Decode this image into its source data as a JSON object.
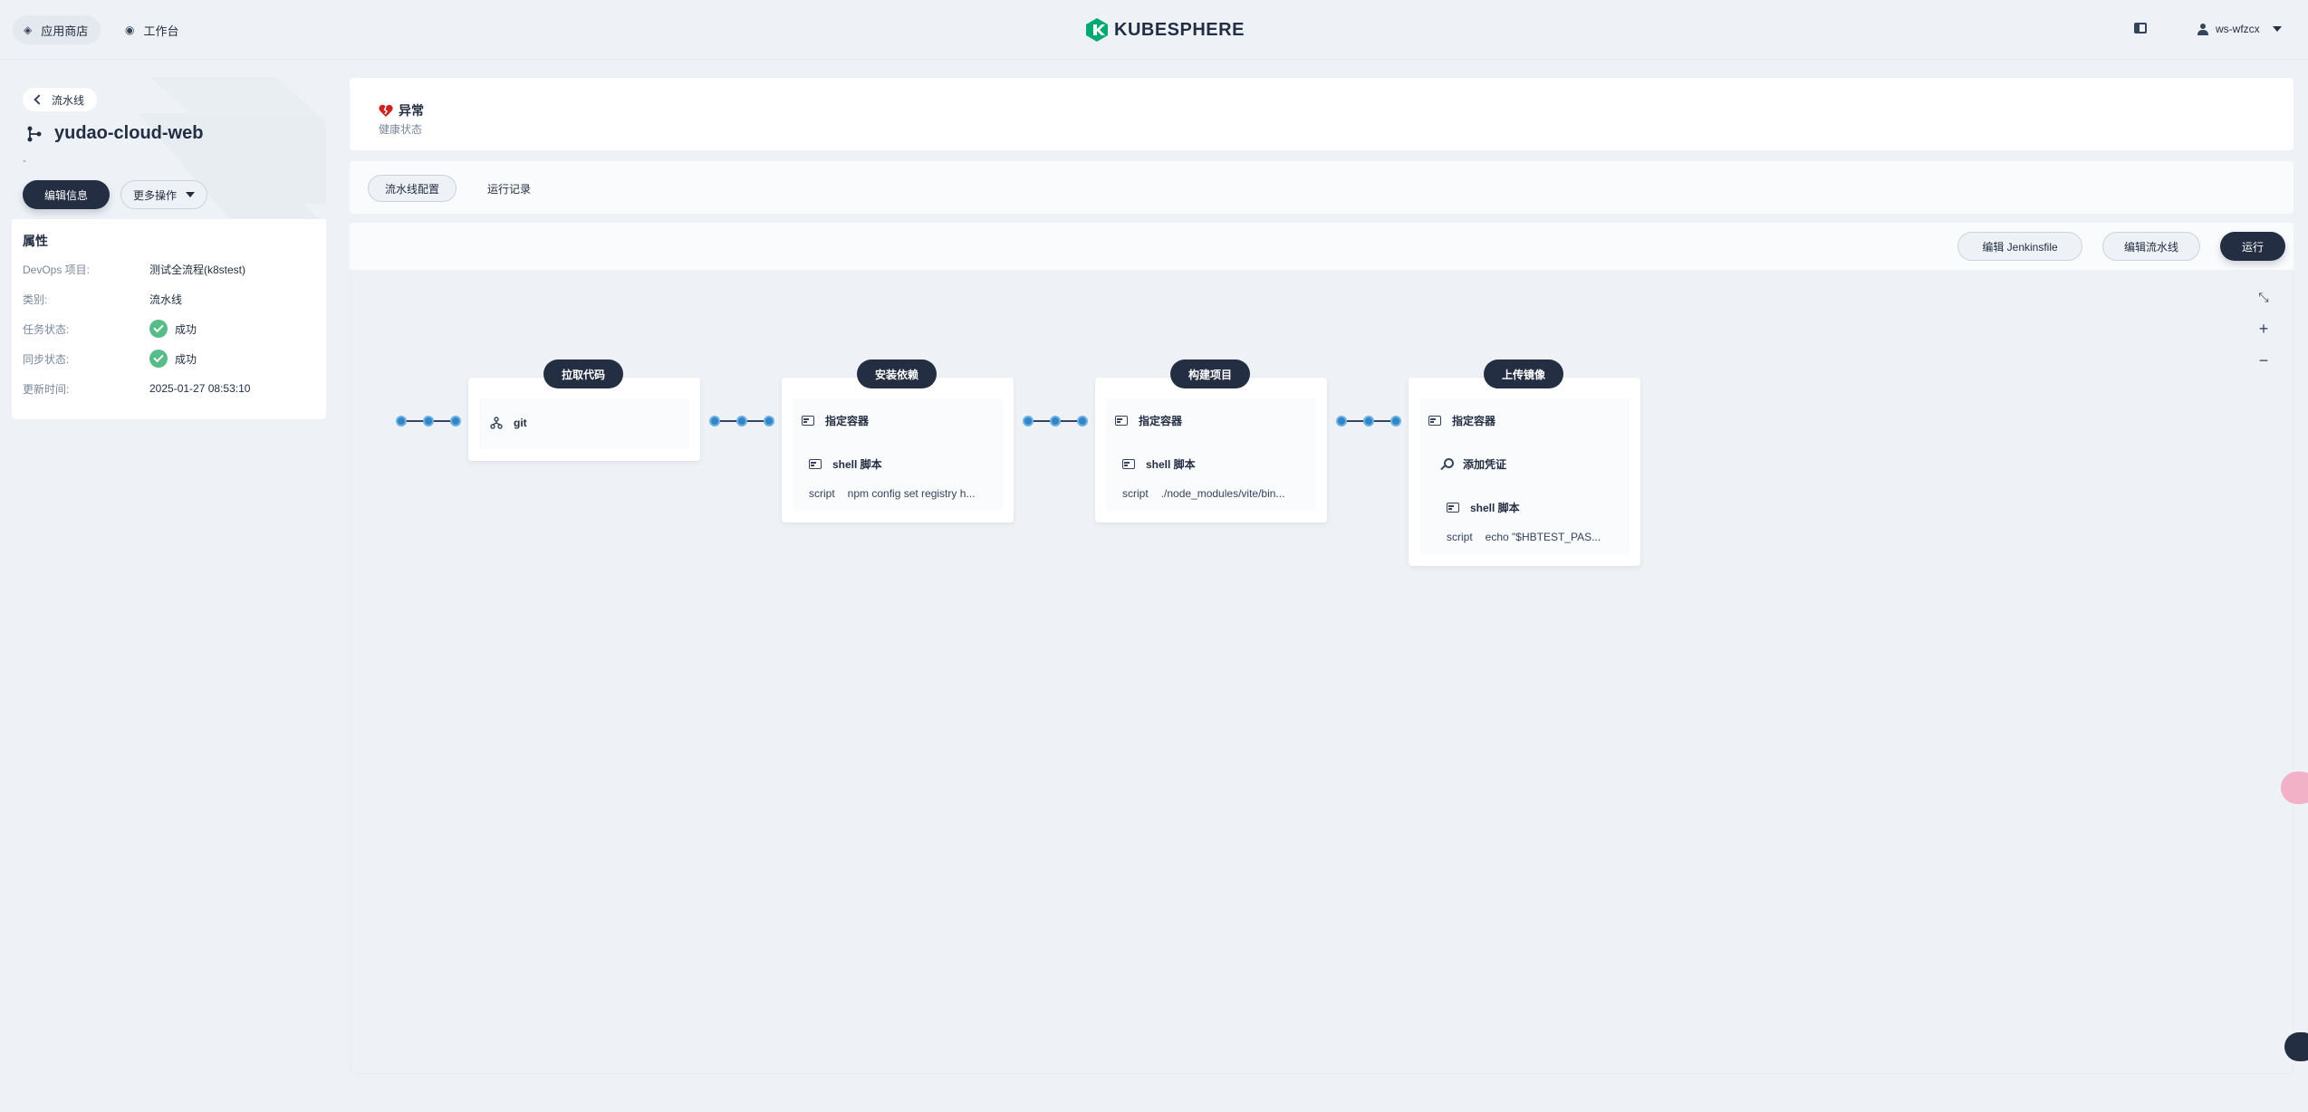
{
  "topbar": {
    "app_store_label": "应用商店",
    "workbench_label": "工作台",
    "logo_text": "KUBESPHERE",
    "brand_color": "#00a971",
    "username": "ws-wfzcx"
  },
  "sidebar": {
    "back_label": "流水线",
    "pipeline_name": "yudao-cloud-web",
    "description": "-",
    "edit_button": "编辑信息",
    "more_button": "更多操作",
    "properties_title": "属性",
    "properties": [
      {
        "key": "DevOps 项目:",
        "value": "测试全流程(k8stest)"
      },
      {
        "key": "类别:",
        "value": "流水线"
      },
      {
        "key": "任务状态:",
        "value": "成功"
      },
      {
        "key": "同步状态:",
        "value": "成功"
      },
      {
        "key": "更新时间:",
        "value": "2025-01-27 08:53:10"
      }
    ]
  },
  "health": {
    "status": "异常",
    "label": "健康状态"
  },
  "tabs": [
    {
      "label": "流水线配置"
    },
    {
      "label": "运行记录"
    }
  ],
  "toolbar": {
    "edit_jenkinsfile": "编辑 Jenkinsfile",
    "edit_pipeline": "编辑流水线",
    "run": "运行"
  },
  "stages": [
    {
      "title": "拉取代码",
      "steps": [
        {
          "label": "git"
        }
      ]
    },
    {
      "title": "安装依赖",
      "steps": [
        {
          "label": "指定容器"
        },
        {
          "label": "shell 脚本",
          "script_key": "script",
          "script_value": "npm config set registry h..."
        }
      ]
    },
    {
      "title": "构建项目",
      "steps": [
        {
          "label": "指定容器"
        },
        {
          "label": "shell 脚本",
          "script_key": "script",
          "script_value": "./node_modules/vite/bin..."
        }
      ]
    },
    {
      "title": "上传镜像",
      "steps": [
        {
          "label": "指定容器"
        },
        {
          "label": "添加凭证"
        },
        {
          "label": "shell 脚本",
          "script_key": "script",
          "script_value": "echo \"$HBTEST_PAS..."
        }
      ]
    }
  ]
}
